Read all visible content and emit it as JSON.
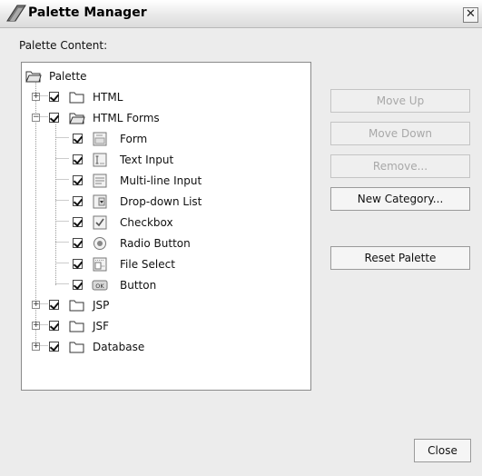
{
  "window": {
    "title": "Palette Manager",
    "close_glyph": "✕"
  },
  "content_label": "Palette Content:",
  "tree": {
    "root": "Palette",
    "html": "HTML",
    "html_forms": "HTML Forms",
    "form": "Form",
    "text_input": "Text Input",
    "multiline_input": "Multi-line Input",
    "dropdown_list": "Drop-down List",
    "checkbox": "Checkbox",
    "radio_button": "Radio Button",
    "file_select": "File Select",
    "button": "Button",
    "jsp": "JSP",
    "jsf": "JSF",
    "database": "Database"
  },
  "buttons": {
    "move_up": "Move Up",
    "move_down": "Move Down",
    "remove": "Remove...",
    "new_category": "New Category...",
    "reset_palette": "Reset Palette",
    "close": "Close"
  },
  "icons": {
    "folder": "folder-icon",
    "open_folder": "open-folder-icon",
    "form": "form-icon",
    "text_input": "text-input-icon",
    "multiline": "multiline-input-icon",
    "dropdown": "dropdown-icon",
    "checkbox": "checkbox-icon",
    "radio": "radio-button-icon",
    "file_select": "file-select-icon",
    "button": "button-icon"
  },
  "state": {
    "expanded_category": "HTML Forms",
    "disabled_buttons": [
      "Move Up",
      "Move Down",
      "Remove..."
    ]
  }
}
